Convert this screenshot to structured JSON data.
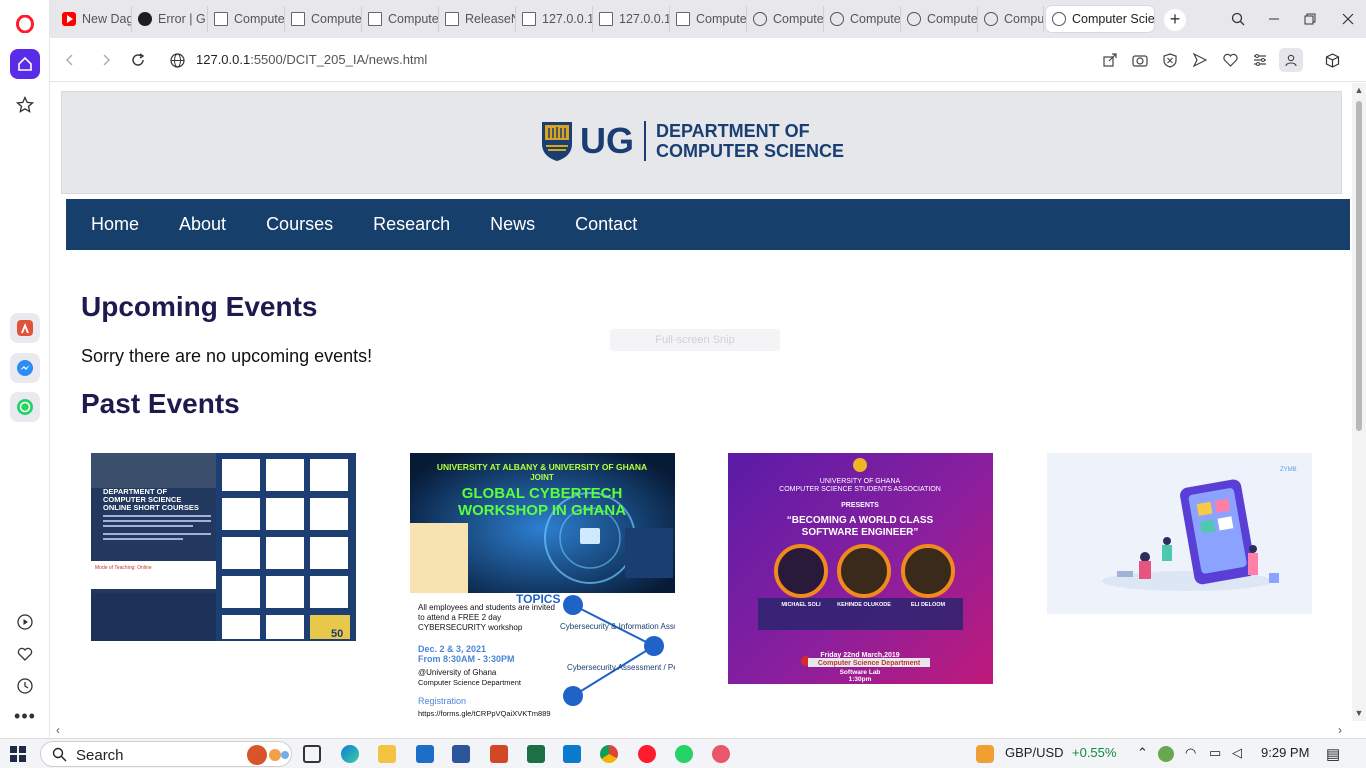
{
  "browser": {
    "tabs": [
      {
        "label": "New Dag",
        "icon": "youtube-icon"
      },
      {
        "label": "Error | G",
        "icon": "github-icon"
      },
      {
        "label": "Compute",
        "icon": "document-icon"
      },
      {
        "label": "Compute",
        "icon": "document-icon"
      },
      {
        "label": "Compute",
        "icon": "document-icon"
      },
      {
        "label": "ReleaseN",
        "icon": "document-icon"
      },
      {
        "label": "127.0.0.1",
        "icon": "document-icon"
      },
      {
        "label": "127.0.0.1",
        "icon": "document-icon"
      },
      {
        "label": "Compute",
        "icon": "document-icon"
      },
      {
        "label": "Compute",
        "icon": "globe-icon"
      },
      {
        "label": "Compute",
        "icon": "globe-icon"
      },
      {
        "label": "Compute",
        "icon": "globe-icon"
      },
      {
        "label": "Compute",
        "icon": "globe-icon"
      },
      {
        "label": "Computer Scien",
        "icon": "globe-icon"
      }
    ],
    "url_host": "127.0.0.1",
    "url_rest": ":5500/DCIT_205_IA/news.html"
  },
  "site": {
    "logo_text": "UG",
    "dept_line1": "DEPARTMENT OF",
    "dept_line2": "COMPUTER SCIENCE",
    "nav": [
      "Home",
      "About",
      "Courses",
      "Research",
      "News",
      "Contact"
    ],
    "upcoming_heading": "Upcoming Events",
    "no_events": "Sorry there are no upcoming events!",
    "past_heading": "Past Events",
    "overlay_text": "Full-screen Snip"
  },
  "posters": {
    "p1": {
      "title1": "DEPARTMENT OF",
      "title2": "COMPUTER SCIENCE",
      "title3": "ONLINE SHORT COURSES",
      "mode": "Mode of Teaching: Online",
      "badge": "50"
    },
    "p2": {
      "line1": "UNIVERSITY AT ALBANY & UNIVERSITY OF GHANA",
      "line2": "JOINT",
      "line3": "GLOBAL CYBERTECH",
      "line4": "WORKSHOP IN GHANA",
      "topics": "TOPICS",
      "t1": "Cybersecurity & Information Assurance",
      "t2": "Cybersecurity Assessment / Penetration Testing",
      "invite": "All employees and students are invited to attend a FREE 2 day CYBERSECURITY workshop",
      "dates": "Dec. 2 & 3, 2021",
      "time": "From 8:30AM - 3:30PM",
      "venue1": "@University of Ghana",
      "venue2": "Computer Science Department",
      "reg": "Registration",
      "link": "https://forms.gle/tCRPpVQaiXVKTm889"
    },
    "p3": {
      "org1": "UNIVERSITY OF GHANA",
      "org2": "COMPUTER SCIENCE STUDENTS ASSOCIATION",
      "presents": "PRESENTS",
      "title1": "“BECOMING A WORLD CLASS",
      "title2": "SOFTWARE ENGINEER”",
      "s1": "MICHAEL SOLI",
      "s2": "KEHINDE OLUKODE",
      "s3": "ELI DELOOM",
      "date": "Friday 22nd March,2019",
      "venue": "Computer Science Department",
      "room": "Software Lab",
      "time": "1:30pm"
    },
    "p4": {
      "brand": "ZYMB"
    }
  },
  "taskbar": {
    "search_label": "Search",
    "ticker": "GBP/USD",
    "ticker_change": "+0.55%",
    "time": "9:29 PM"
  }
}
